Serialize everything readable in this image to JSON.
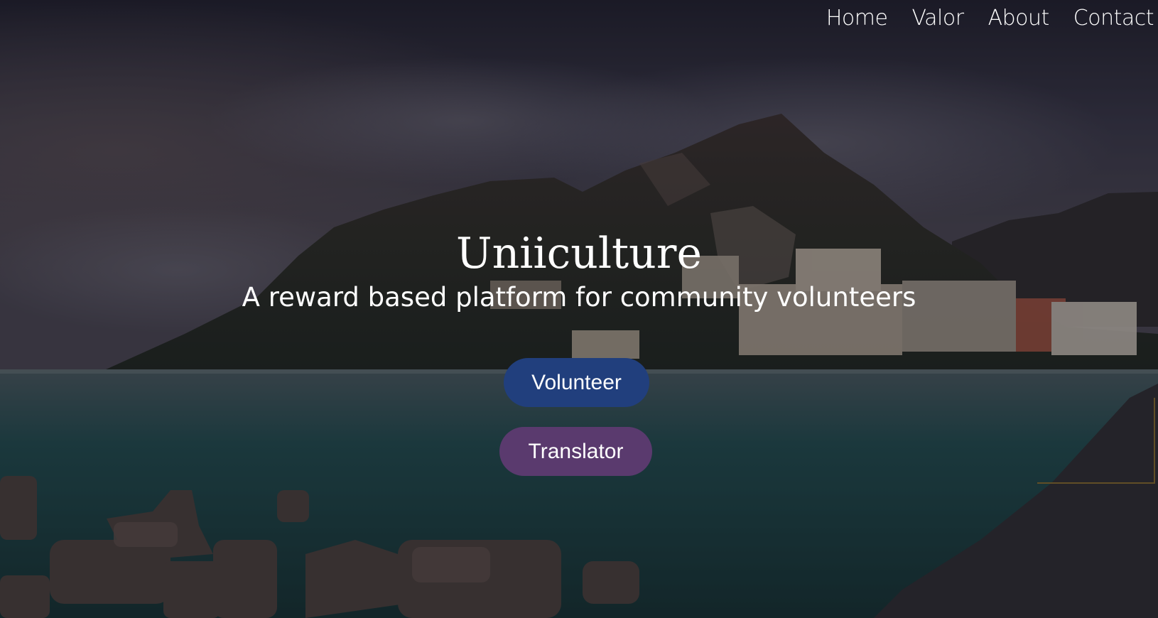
{
  "nav": {
    "items": [
      {
        "label": "Home"
      },
      {
        "label": "Valor"
      },
      {
        "label": "About"
      },
      {
        "label": "Contact"
      }
    ]
  },
  "hero": {
    "title": "Uniiculture",
    "subtitle": "A reward based platform for community volunteers",
    "background": "coastal-town-mountain-photo"
  },
  "buttons": {
    "volunteer": {
      "label": "Volunteer",
      "color": "#213f7d"
    },
    "translator": {
      "label": "Translator",
      "color": "#5a3a6e"
    }
  }
}
